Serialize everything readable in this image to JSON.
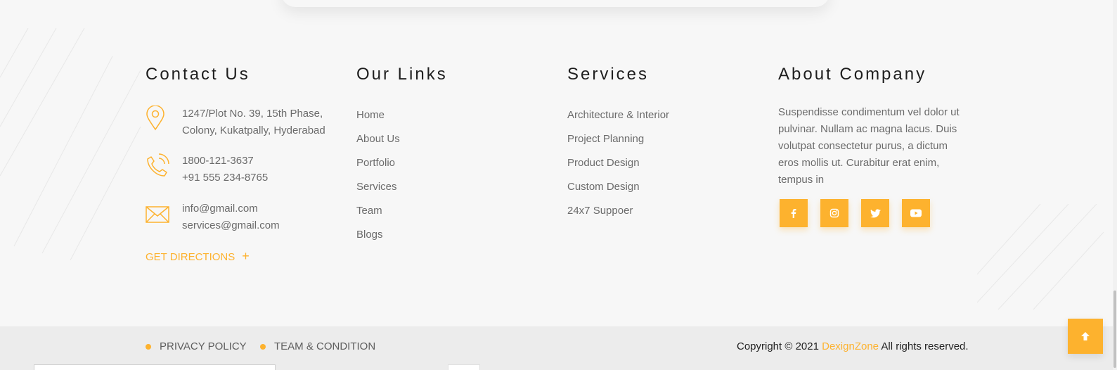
{
  "contact": {
    "title": "Contact Us",
    "address_line1": "1247/Plot No. 39, 15th Phase,",
    "address_line2": "Colony, Kukatpally, Hyderabad",
    "phone1": "1800-121-3637",
    "phone2": "+91 555 234-8765",
    "email1": "info@gmail.com",
    "email2": "services@gmail.com",
    "directions_label": "GET DIRECTIONS",
    "directions_icon": "plus-icon"
  },
  "links": {
    "title": "Our Links",
    "items": [
      "Home",
      "About Us",
      "Portfolio",
      "Services",
      "Team",
      "Blogs"
    ]
  },
  "services": {
    "title": "Services",
    "items": [
      "Architecture & Interior",
      "Project Planning",
      "Product Design",
      "Custom Design",
      "24x7 Suppoer"
    ]
  },
  "about": {
    "title": "About Company",
    "text": "Suspendisse condimentum vel dolor ut pulvinar. Nullam ac magna lacus. Duis volutpat consectetur purus, a dictum eros mollis ut. Curabitur erat enim, tempus in",
    "socials": [
      "facebook-icon",
      "instagram-icon",
      "twitter-icon",
      "youtube-icon"
    ]
  },
  "footer": {
    "privacy": "PRIVACY POLICY",
    "terms": "TEAM & CONDITION",
    "copyright_prefix": "Copyright © 2021",
    "brand": "DexignZone",
    "copyright_suffix": "All rights reserved."
  },
  "colors": {
    "accent": "#fdb22e",
    "background": "#f7f7f7",
    "bottom_bar": "#ececec",
    "heading": "#1e1e1e",
    "text": "#6b6b6b"
  }
}
